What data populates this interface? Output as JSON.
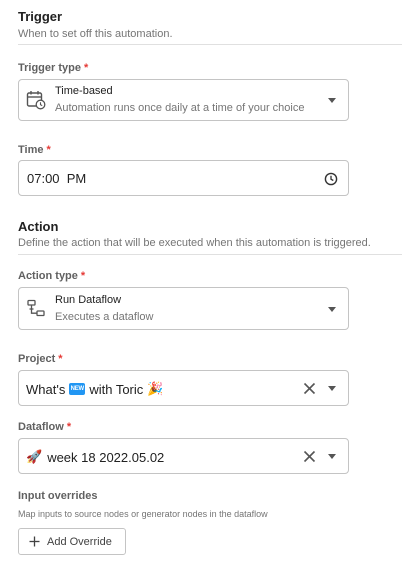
{
  "trigger": {
    "title": "Trigger",
    "subtitle": "When to set off this automation.",
    "type_label": "Trigger type",
    "type_value": "Time-based",
    "type_desc": "Automation runs once daily at a time of your choice",
    "time_label": "Time",
    "time_value": "07:00  PM"
  },
  "action": {
    "title": "Action",
    "subtitle": "Define the action that will be executed when this automation is triggered.",
    "type_label": "Action type",
    "type_value": "Run Dataflow",
    "type_desc": "Executes a dataflow",
    "project_label": "Project",
    "project_prefix": "What's",
    "project_badge": "NEW",
    "project_suffix": "with Toric",
    "project_emoji": "🎉",
    "dataflow_label": "Dataflow",
    "dataflow_emoji": "🚀",
    "dataflow_value": "week 18 2022.05.02"
  },
  "overrides": {
    "label": "Input overrides",
    "desc": "Map inputs to source nodes or generator nodes in the dataflow",
    "button_label": "Add Override"
  },
  "common": {
    "required_mark": "*"
  },
  "colors": {
    "required": "#e53935",
    "new_badge": "#2196f3",
    "border": "#c4c4c4"
  }
}
